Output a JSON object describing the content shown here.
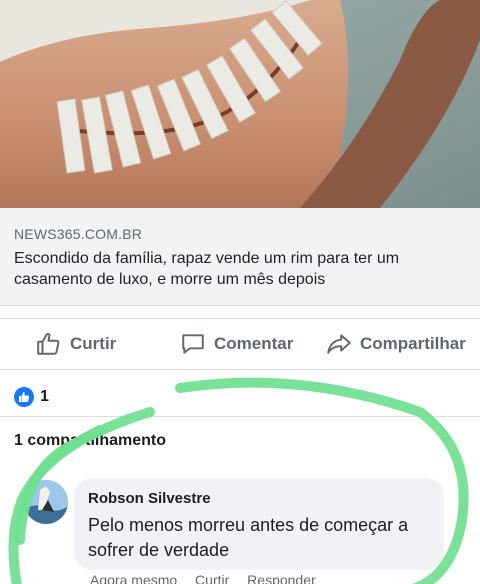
{
  "link": {
    "domain": "NEWS365.COM.BR",
    "title": "Escondido da família, rapaz vende um rim para ter um casamento de luxo, e morre um mês depois"
  },
  "actions": {
    "like": "Curtir",
    "comment": "Comentar",
    "share": "Compartilhar"
  },
  "reactions": {
    "count": "1"
  },
  "shares": {
    "text": "1 compartilhamento"
  },
  "comment": {
    "author": "Robson Silvestre",
    "text": "Pelo menos morreu antes de começar a sofrer de verdade",
    "meta": [
      "Agora mesmo",
      "Curtir",
      "Responder"
    ]
  },
  "icons": {
    "like": "thumbs-up-icon",
    "comment": "comment-bubble-icon",
    "share": "share-arrow-icon",
    "reaction": "like-reaction-icon"
  },
  "colors": {
    "accent": "#1877f2",
    "marker": "#6fe08f",
    "caption_bg": "#f2f3f5"
  }
}
